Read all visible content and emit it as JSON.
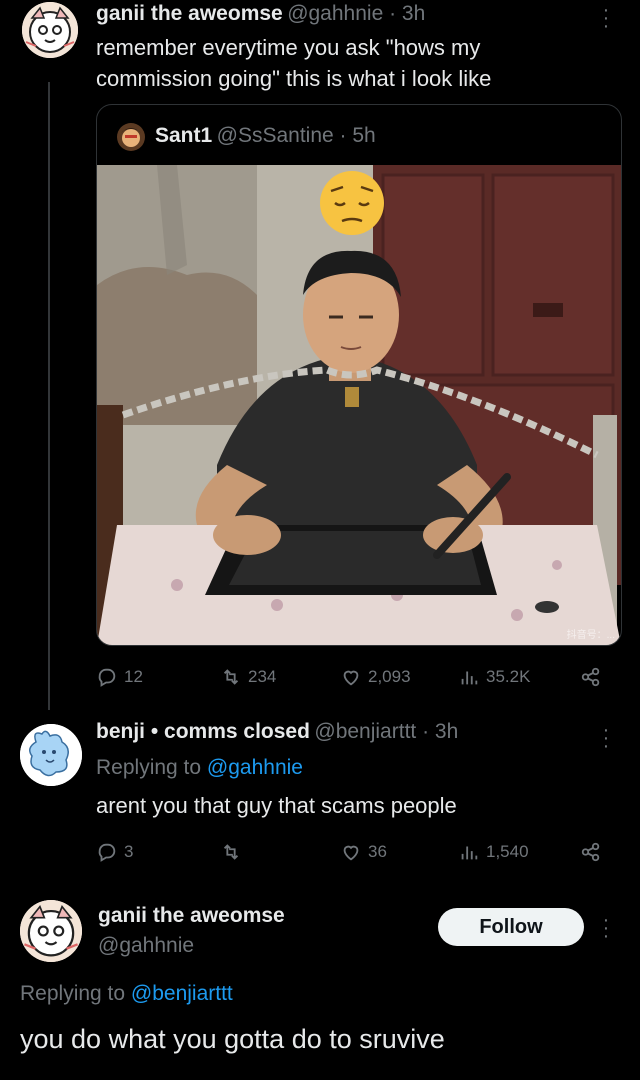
{
  "thread": {
    "tweet1": {
      "name": "ganii the aweomse",
      "handle_time": "@gahhnie · 3h",
      "text_line1": "remember everytime you ask \"hows my",
      "text_line2": "commission going\" this is what i look like",
      "quote": {
        "name": "Sant1",
        "handle_time": "@SsSantine · 5h",
        "watermark": "抖音号：..."
      },
      "actions": {
        "replies": "12",
        "reposts": "234",
        "likes": "2,093",
        "views": "35.2K"
      }
    },
    "tweet2": {
      "name": "benji • comms closed",
      "handle_time": "@benjiarttt · 3h",
      "replying_prefix": "Replying to ",
      "replying_handle": "@gahhnie",
      "text": "arent you that guy that scams people",
      "actions": {
        "replies": "3",
        "reposts": "",
        "likes": "36",
        "views": "1,540"
      }
    },
    "focus": {
      "name": "ganii the aweomse",
      "handle": "@gahhnie",
      "follow_label": "Follow",
      "replying_prefix": "Replying to ",
      "replying_handle": "@benjiarttt",
      "text": "you do what you gotta do to sruvive"
    }
  },
  "colors": {
    "background": "#000000",
    "text": "#e7e9ea",
    "muted": "#71767b",
    "link": "#1d9bf0",
    "border": "#2f3336"
  },
  "icons": [
    "reply-icon",
    "repost-icon",
    "like-icon",
    "views-icon",
    "share-icon",
    "more-icon"
  ]
}
